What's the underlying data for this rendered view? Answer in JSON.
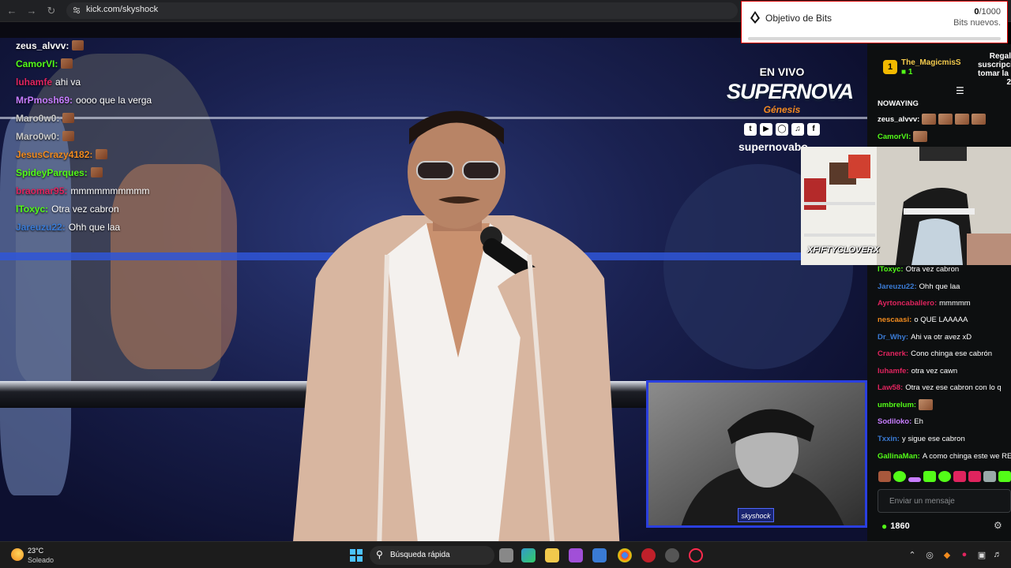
{
  "browser": {
    "url": "kick.com/skyshock"
  },
  "stream_overlay": {
    "chat": [
      {
        "user": "zeus_alvvv:",
        "user_color": "#ffffff",
        "message": "",
        "emote": true
      },
      {
        "user": "CamorVI:",
        "user_color": "#53fc18",
        "message": "",
        "emote": true
      },
      {
        "user": "luhamfe",
        "user_color": "#e0245e",
        "message": "ahi va",
        "emote": false
      },
      {
        "user": "MrPmosh69:",
        "user_color": "#c77dff",
        "message": "oooo que la verga",
        "emote": false
      },
      {
        "user": "Maro0w0:",
        "user_color": "#cccccc",
        "message": "",
        "emote": true
      },
      {
        "user": "Maro0w0:",
        "user_color": "#cccccc",
        "message": "",
        "emote": true
      },
      {
        "user": "JesusCrazy4182:",
        "user_color": "#f28b1e",
        "message": "",
        "emote": true
      },
      {
        "user": "SpideyParques:",
        "user_color": "#53fc18",
        "message": "",
        "emote": true
      },
      {
        "user": "braomar95:",
        "user_color": "#e0245e",
        "message": "mmmmmmmmmm",
        "emote": false
      },
      {
        "user": "lToxyc:",
        "user_color": "#53fc18",
        "message": "Otra vez cabron",
        "emote": false
      },
      {
        "user": "Jareuzu22:",
        "user_color": "#3a7bd5",
        "message": "Ohh que laa",
        "emote": false
      }
    ],
    "live_label": "EN VIVO",
    "brand_name": "SUPERNOVA",
    "brand_sub": "Génesis",
    "brand_handle": "supernovabo",
    "webcam_tag": "skyshock"
  },
  "bits_goal": {
    "title": "Objetivo de Bits",
    "current": "0",
    "goal": "/1000",
    "subtitle": "Bits nuevos.",
    "progress": 0
  },
  "chat_panel": {
    "pinned": {
      "gifter": "The_MagicmisS",
      "gift_count": "1",
      "gift_text_1": "Regal",
      "gift_text_2": "suscripci",
      "gift_text_3": "tomar la p",
      "gift_text_4": "2"
    },
    "messages": [
      {
        "user": "NOWAYING",
        "user_color": "#ffffff",
        "message": "",
        "emotes": 0
      },
      {
        "user": "zeus_alvvv:",
        "user_color": "#ffffff",
        "message": "",
        "emotes": 4
      },
      {
        "user": "CamorVI:",
        "user_color": "#53fc18",
        "message": "",
        "emotes": 1
      },
      {
        "user": "lToxyc:",
        "user_color": "#53fc18",
        "message": "Otra vez cabron",
        "emotes": 0
      },
      {
        "user": "Jareuzu22:",
        "user_color": "#3a7bd5",
        "message": "Ohh que laa",
        "emotes": 0
      },
      {
        "user": "Ayrtoncaballero:",
        "user_color": "#e0245e",
        "message": "mmmmm",
        "emotes": 0
      },
      {
        "user": "nescaasi:",
        "user_color": "#f28b1e",
        "message": "o QUE LAAAAA",
        "emotes": 0
      },
      {
        "user": "Dr_Why:",
        "user_color": "#3a7bd5",
        "message": "Ahi va otr avez xD",
        "emotes": 0
      },
      {
        "user": "Cranerk:",
        "user_color": "#e0245e",
        "message": "Cono chinga ese cabrón",
        "emotes": 0
      },
      {
        "user": "luhamfe:",
        "user_color": "#e0245e",
        "message": "otra vez cawn",
        "emotes": 0
      },
      {
        "user": "Law58:",
        "user_color": "#e0245e",
        "message": "Otra vez ese cabron con lo q",
        "emotes": 0
      },
      {
        "user": "umbrelum:",
        "user_color": "#53fc18",
        "message": "",
        "emotes": 1
      },
      {
        "user": "Sodiloko:",
        "user_color": "#c77dff",
        "message": "Eh",
        "emotes": 0
      },
      {
        "user": "Txxin:",
        "user_color": "#3a7bd5",
        "message": "y sigue ese cabron",
        "emotes": 0
      },
      {
        "user": "GallinaMan:",
        "user_color": "#53fc18",
        "message": "A como chinga este we RE",
        "emotes": 0
      }
    ],
    "streamer_cam_name": "XFIFTYCLOVERX",
    "message_placeholder": "Enviar un mensaje",
    "points": "1860"
  },
  "taskbar": {
    "temperature": "23°C",
    "weather": "Soleado",
    "search_placeholder": "Búsqueda rápida"
  },
  "colors": {
    "kick_green": "#53fc18",
    "overlay_blue": "#2a3fe0"
  }
}
